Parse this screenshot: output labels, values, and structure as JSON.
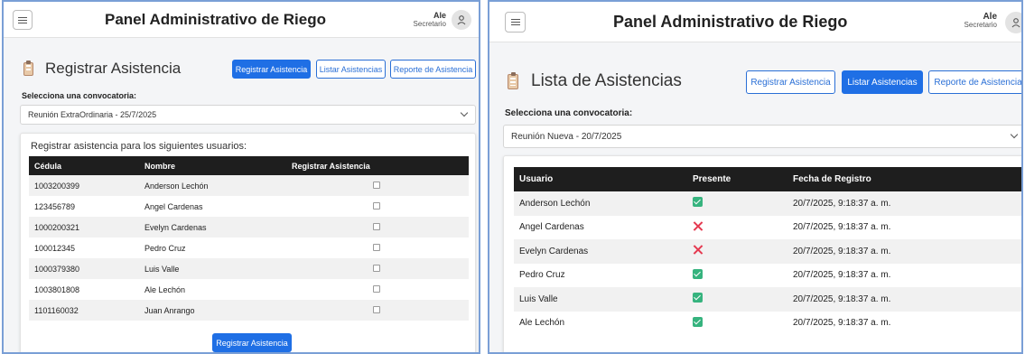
{
  "left": {
    "header": {
      "title": "Panel Administrativo de Riego",
      "user_name": "Ale",
      "user_role": "Secretario"
    },
    "page_title": "Registrar Asistencia",
    "tabs": [
      {
        "label": "Registrar Asistencia",
        "active": true
      },
      {
        "label": "Listar Asistencias",
        "active": false
      },
      {
        "label": "Reporte de Asistencia",
        "active": false
      }
    ],
    "select_label": "Selecciona una convocatoria:",
    "select_value": "Reunión ExtraOrdinaria - 25/7/2025",
    "card_title": "Registrar asistencia para los siguientes usuarios:",
    "columns": [
      "Cédula",
      "Nombre",
      "Registrar Asistencia"
    ],
    "rows": [
      {
        "cedula": "1003200399",
        "nombre": "Anderson Lechón"
      },
      {
        "cedula": "123456789",
        "nombre": "Angel Cardenas"
      },
      {
        "cedula": "1000200321",
        "nombre": "Evelyn Cardenas"
      },
      {
        "cedula": "100012345",
        "nombre": "Pedro Cruz"
      },
      {
        "cedula": "1000379380",
        "nombre": "Luis Valle"
      },
      {
        "cedula": "1003801808",
        "nombre": "Ale Lechón"
      },
      {
        "cedula": "1101160032",
        "nombre": "Juan Anrango"
      }
    ],
    "submit_label": "Registrar Asistencia"
  },
  "right": {
    "header": {
      "title": "Panel Administrativo de Riego",
      "user_name": "Ale",
      "user_role": "Secretario"
    },
    "page_title": "Lista de Asistencias",
    "tabs": [
      {
        "label": "Registrar Asistencia",
        "active": false
      },
      {
        "label": "Listar Asistencias",
        "active": true
      },
      {
        "label": "Reporte de Asistencia",
        "active": false
      }
    ],
    "select_label": "Selecciona una convocatoria:",
    "select_value": "Reunión Nueva - 20/7/2025",
    "columns": [
      "Usuario",
      "Presente",
      "Fecha de Registro"
    ],
    "rows": [
      {
        "usuario": "Anderson Lechón",
        "presente": true,
        "fecha": "20/7/2025, 9:18:37 a. m."
      },
      {
        "usuario": "Angel Cardenas",
        "presente": false,
        "fecha": "20/7/2025, 9:18:37 a. m."
      },
      {
        "usuario": "Evelyn Cardenas",
        "presente": false,
        "fecha": "20/7/2025, 9:18:37 a. m."
      },
      {
        "usuario": "Pedro Cruz",
        "presente": true,
        "fecha": "20/7/2025, 9:18:37 a. m."
      },
      {
        "usuario": "Luis Valle",
        "presente": true,
        "fecha": "20/7/2025, 9:18:37 a. m."
      },
      {
        "usuario": "Ale Lechón",
        "presente": true,
        "fecha": "20/7/2025, 9:18:37 a. m."
      }
    ]
  },
  "icons": {
    "menu": "hamburger-menu-icon",
    "avatar": "user-icon",
    "title": "clipboard-icon",
    "dropdown": "chevron-down-icon",
    "present": "check-icon",
    "absent": "cross-icon"
  },
  "colors": {
    "primary": "#1f6fe5",
    "table_header": "#1e1e1e",
    "present": "#36b37e",
    "absent": "#e53950"
  }
}
